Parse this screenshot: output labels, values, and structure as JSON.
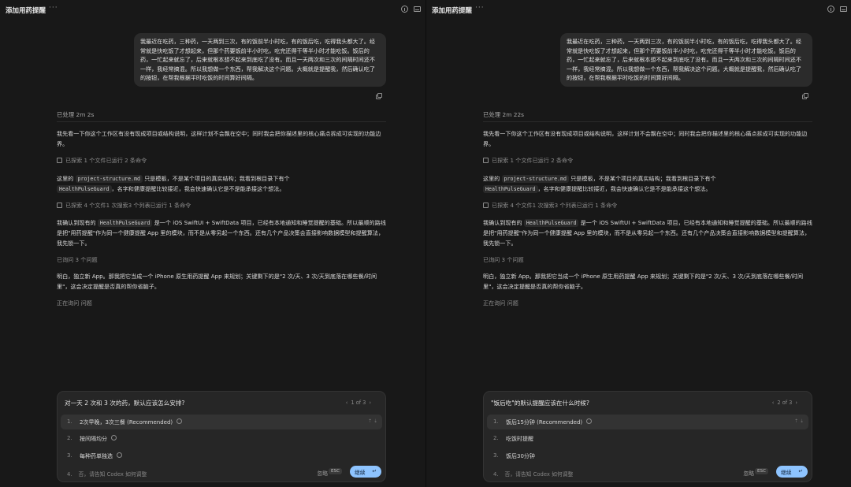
{
  "panes": [
    {
      "title": "添加用药提醒",
      "more": "···",
      "user_message": "我最近在吃药，三种药，一天两到三次，有的饭前半小时吃，有的饭后吃，吃得我头都大了。经常就是快吃饭了才想起来，但那个药要饭前半小时吃，吃完还得干等半小时才能吃饭。饭后的药，一忙起来就忘了，后来就根本想不起来到底吃了没有。而且一天两次和三次的间隔时间还不一样，我经常搞混。所以我想做一个东西，帮我解决这个问题。大概就是提醒我，然后确认吃了的按钮，在帮我根据平时吃饭的时间算好间隔。",
      "processed": "已处理 2m 2s",
      "p1": "我先看一下你这个工作区有没有现成项目或结构说明，这样计划不会飘在空中；同时我会把你描述里的核心痛点拆成可实现的功能边界。",
      "explored1": "已探索 1 个文件已运行 2 条命令",
      "p2_a": "这里的",
      "p2_code1": "project-structure.md",
      "p2_b": "只是模板，不是某个项目的真实结构；我看到根目录下有个",
      "p2_code2": "HealthPulseGuard",
      "p2_c": "，名字和健康提醒比较接近，我会快速确认它是不是能承接这个想法。",
      "explored2": "已探索 4 个文件1 次搜索3 个列表已运行 1 条命令",
      "p3_a": "我确认到现有的",
      "p3_code": "HealthPulseGuard",
      "p3_b": "是一个 iOS SwiftUI + SwiftData 项目，已经有本地通知和睡觉提醒的基础。所以最顺的路线是把\"用药提醒\"作为同一个健康提醒 App 里的模块，而不是从零另起一个东西。还有几个产品决策会直接影响数据模型和提醒算法，我先锁一下。",
      "asked": "已询问 3 个问题",
      "p4": "明白，独立新 App。那我把它当成一个 iPhone 原生用药提醒 App 来规划；关键剩下的是\"2 次/天、3 次/天到底落在哪些餐/时间里\"，这会决定提醒是否真的帮你省脑子。",
      "asking": "正在询问 问题",
      "panel": {
        "question": "对一天 2 次和 3 次的药，默认应该怎么安排?",
        "pager": "1 of 3",
        "options": [
          {
            "num": "1.",
            "label": "2次早晚，3次三餐 (Recommended)",
            "info": true,
            "keys": "⇡ ⇣"
          },
          {
            "num": "2.",
            "label": "按间隔均分",
            "info": true,
            "keys": ""
          },
          {
            "num": "3.",
            "label": "每种药单独选",
            "info": true,
            "keys": ""
          }
        ],
        "other_num": "4.",
        "other": "否，请告知 Codex 如何调整",
        "dismiss": "忽略",
        "esc": "ESC",
        "continue": "继续",
        "ret": "↵"
      }
    },
    {
      "title": "添加用药提醒",
      "more": "···",
      "user_message": "我最近在吃药，三种药，一天两到三次，有的饭前半小时吃，有的饭后吃，吃得我头都大了。经常就是快吃饭了才想起来，但那个药要饭前半小时吃，吃完还得干等半小时才能吃饭。饭后的药，一忙起来就忘了，后来就根本想不起来到底吃了没有。而且一天两次和三次的间隔时间还不一样，我经常搞混。所以我想做一个东西，帮我解决这个问题。大概就是提醒我，然后确认吃了的按钮，在帮我根据平时吃饭的时间算好间隔。",
      "processed": "已处理 2m 22s",
      "p1": "我先看一下你这个工作区有没有现成项目或结构说明，这样计划不会飘在空中；同时我会把你描述里的核心痛点拆成可实现的功能边界。",
      "explored1": "已探索 1 个文件已运行 2 条命令",
      "p2_a": "这里的",
      "p2_code1": "project-structure.md",
      "p2_b": "只是模板，不是某个项目的真实结构；我看到根目录下有个",
      "p2_code2": "HealthPulseGuard",
      "p2_c": "，名字和健康提醒比较接近，我会快速确认它是不是能承接这个想法。",
      "explored2": "已探索 4 个文件1 次搜索3 个列表已运行 1 条命令",
      "p3_a": "我确认到现有的",
      "p3_code": "HealthPulseGuard",
      "p3_b": "是一个 iOS SwiftUI + SwiftData 项目，已经有本地通知和睡觉提醒的基础。所以最顺的路线是把\"用药提醒\"作为同一个健康提醒 App 里的模块，而不是从零另起一个东西。还有几个产品决策会直接影响数据模型和提醒算法，我先锁一下。",
      "asked": "已询问 3 个问题",
      "p4": "明白，独立新 App。那我把它当成一个 iPhone 原生用药提醒 App 来规划；关键剩下的是\"2 次/天、3 次/天到底落在哪些餐/时间里\"，这会决定提醒是否真的帮你省脑子。",
      "asking": "正在询问 问题",
      "panel": {
        "question": "\"饭后吃\"的默认提醒应该在什么时候?",
        "pager": "2 of 3",
        "options": [
          {
            "num": "1.",
            "label": "饭后15分钟 (Recommended)",
            "info": true,
            "keys": "⇡ ⇣"
          },
          {
            "num": "2.",
            "label": "吃饭时提醒",
            "info": false,
            "keys": ""
          },
          {
            "num": "3.",
            "label": "饭后30分钟",
            "info": false,
            "keys": ""
          }
        ],
        "other_num": "4.",
        "other": "否，请告知 Codex 如何调整",
        "dismiss": "忽略",
        "esc": "ESC",
        "continue": "继续",
        "ret": "↵"
      }
    }
  ]
}
